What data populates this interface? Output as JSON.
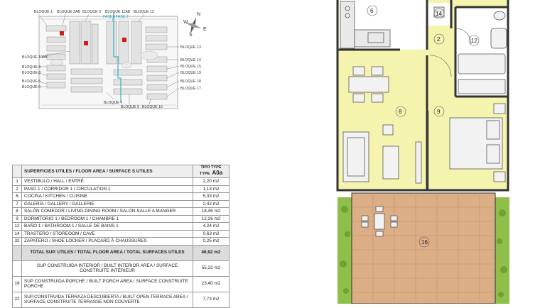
{
  "site_plan": {
    "compass": [
      "N",
      "E",
      "S",
      "W"
    ],
    "blocks_top": [
      "BLOQUE 1",
      "BLOQUE 2AB",
      "BLOQUE 3",
      "BLOQUE 11AB",
      "BLOQUE 12"
    ],
    "phase_labels": [
      "FASE 1",
      "FASE 2"
    ],
    "blocks_left": [
      "BLOQUE 10AB",
      "BLOQUE 4",
      "BLOQUE 8",
      "BLOQUE 5",
      "BLOQUE 6"
    ],
    "blocks_right": [
      "BLOQUE 13",
      "BLOQUE 14",
      "BLOQUE 15",
      "BLOQUE 19",
      "BLOQUE 18",
      "BLOQUE 17"
    ],
    "blocks_bottom": [
      "BLOQUE 7",
      "BLOQUE 9",
      "BLOQUE 16"
    ]
  },
  "table": {
    "header": {
      "col_label": "SUPERFICIES UTILES / FLOOR AREA / SURFACE S UTILES",
      "type_line1": "TIPO TYPE",
      "type_line2": "TYPE",
      "type_code": "A0a"
    },
    "rows": [
      {
        "n": "1",
        "label": "VESTIBULO / HALL / ENTRÉ",
        "value": "2,20 m2"
      },
      {
        "n": "2",
        "label": "PASO 1 / CORRIDOR 1 / CIRCULATION 1",
        "value": "1,13 m2"
      },
      {
        "n": "6",
        "label": "COCINA / KITCHEN / CUISINE",
        "value": "5,33 m2"
      },
      {
        "n": "7",
        "label": "GALERÍA / GALLERY / GALLERIE",
        "value": "2,42 m2"
      },
      {
        "n": "8",
        "label": "SALÓN COMEDOR  / LIVING-DINING ROOM / SALON-SALLE A MANGER",
        "value": "18,46 m2"
      },
      {
        "n": "9",
        "label": "DORMITORIO 1 / BEDROOM 1 / CHAMBRE 1",
        "value": "12,26 m2"
      },
      {
        "n": "12",
        "label": "BAÑO 1 / BATHROOM 1 / SALLE DE BAINS 1",
        "value": "4,24 m2"
      },
      {
        "n": "14",
        "label": "TRASTERO / STOREOOM / CAVE",
        "value": "0,63 m2"
      },
      {
        "n": "32",
        "label": "ZAPATERO / SHOE LOCKER / PLACARD À CHAUSSURES",
        "value": "0,25 m2"
      }
    ],
    "total": {
      "label": "TOTAL SUP. UTILES / TOTAL FLOOR AREA / TOTAL SURFACES UTILES",
      "value": "46,92 m2"
    },
    "built_interior": {
      "label": "SUP CONSTRUIDA INTERIOR / BUILT INTERIOR AREA /  SURFACE CONSTRUITE INTÉRIEUR",
      "value": "55,32 m2"
    },
    "porch": {
      "n": "16",
      "label": "SUP CONSTRUIDA PORCHE  / BUILT PORCH  AREA / SURFACE CONSTRUITE PORCHE",
      "value": "23,40 m2"
    },
    "terrace": {
      "n": "22",
      "label": "SUP.CONSTRUIDA TERRAZA DESCUBIERTA  / BUILT OPEN TERRACE  AREA / SURFACE CONSTRUITE TERRASSE NON COUVERTE",
      "value": "7,73 m2"
    }
  },
  "floor_plan": {
    "room_numbers": [
      "6",
      "14",
      "2",
      "12",
      "8",
      "9",
      "16"
    ],
    "colors": {
      "interior": "#f5f4ae",
      "terrace": "#dcae86",
      "planting": "#8fbf4a",
      "walls": "#333333"
    }
  }
}
